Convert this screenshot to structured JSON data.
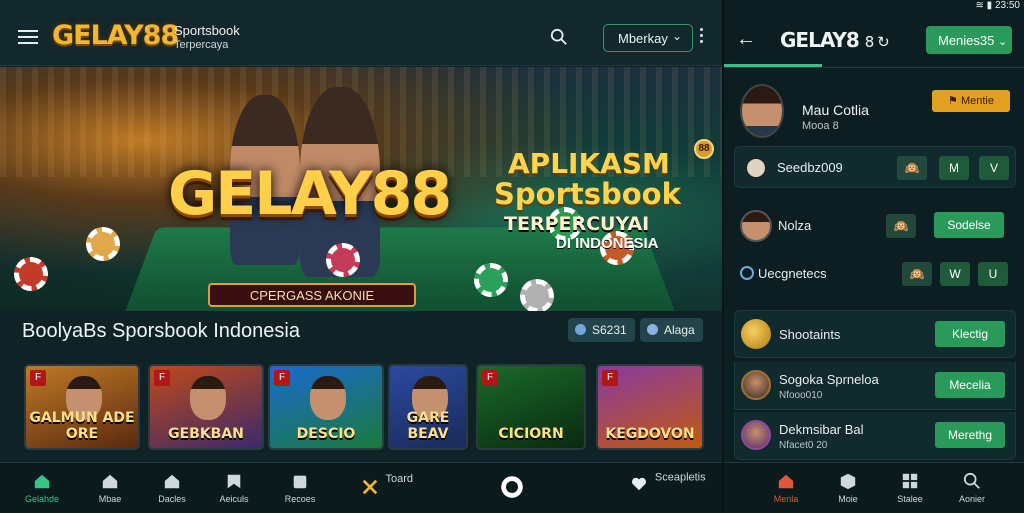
{
  "left": {
    "header": {
      "logo": "GELAY88",
      "logo_sub1": "Sportsbook",
      "logo_sub2": "Terpercaya",
      "dropdown": "Mberkay"
    },
    "hero": {
      "logo": "GELAY88",
      "tagline": "CPERGASS AKONIE",
      "headline1": "APLIKASM",
      "headline2": "Sportsbook",
      "headline3": "TERPERCUYAI",
      "headline4": "DI INDONESIA",
      "badge": "88"
    },
    "section_title": "BoolyaBs Sporsbook Indonesia",
    "chips": [
      {
        "label": "S6231"
      },
      {
        "label": "Alaga"
      }
    ],
    "games": [
      {
        "label": "GALMUN ADE ORE",
        "tag": "F",
        "colors": [
          "#c07a25",
          "#5a2a10"
        ]
      },
      {
        "label": "GEBKBAN",
        "tag": "F",
        "colors": [
          "#c04a1a",
          "#3a2a6a"
        ]
      },
      {
        "label": "DESCIO",
        "tag": "F",
        "colors": [
          "#1a6ad0",
          "#1a7a3a"
        ]
      },
      {
        "label": "GARE BEAV",
        "tag": "",
        "colors": [
          "#2a4aa0",
          "#1a2a5a"
        ]
      },
      {
        "label": "CICIORN",
        "tag": "F",
        "colors": [
          "#1a6a2a",
          "#0a2a10"
        ]
      },
      {
        "label": "KEGDOVON",
        "tag": "F",
        "colors": [
          "#8a3aa0",
          "#c05a10"
        ]
      }
    ],
    "nav": [
      {
        "label": "Gelahde",
        "active": true
      },
      {
        "label": "Mbae"
      },
      {
        "label": "Dacles"
      },
      {
        "label": "Aeiculs"
      },
      {
        "label": "Recoes"
      },
      {
        "label": "Toard"
      },
      {
        "label": ""
      },
      {
        "label": "Sceapletis"
      }
    ]
  },
  "right": {
    "header": {
      "logo": "GELAY8",
      "suffix": "8 ↻",
      "button": "Menies35",
      "status_time": "23:50"
    },
    "profile": {
      "name": "Mau Cotlia",
      "sub": "Mooa 8",
      "badge": "Mentie"
    },
    "rows": [
      {
        "label": "Seedbz009",
        "btn1": "🙉",
        "btn2": "M",
        "btn3": "V"
      },
      {
        "label": "Nolza",
        "btn1": "🙉",
        "btn2": "Sodelse"
      },
      {
        "label": "Uecgnetecs",
        "btn1": "🙉",
        "btn2": "W",
        "btn3": "U"
      },
      {
        "label": "Shootaints",
        "btn2": "Klectig"
      },
      {
        "label": "Sogoka Sprneloa",
        "sub": "Nfooo010",
        "btn2": "Mecelia"
      },
      {
        "label": "Dekmsibar Bal",
        "sub": "Nfacet0 20",
        "btn2": "Merethg"
      }
    ],
    "nav": [
      {
        "label": "Menla",
        "active": true
      },
      {
        "label": "Moie"
      },
      {
        "label": "Stalee"
      },
      {
        "label": "Aonier"
      }
    ]
  }
}
